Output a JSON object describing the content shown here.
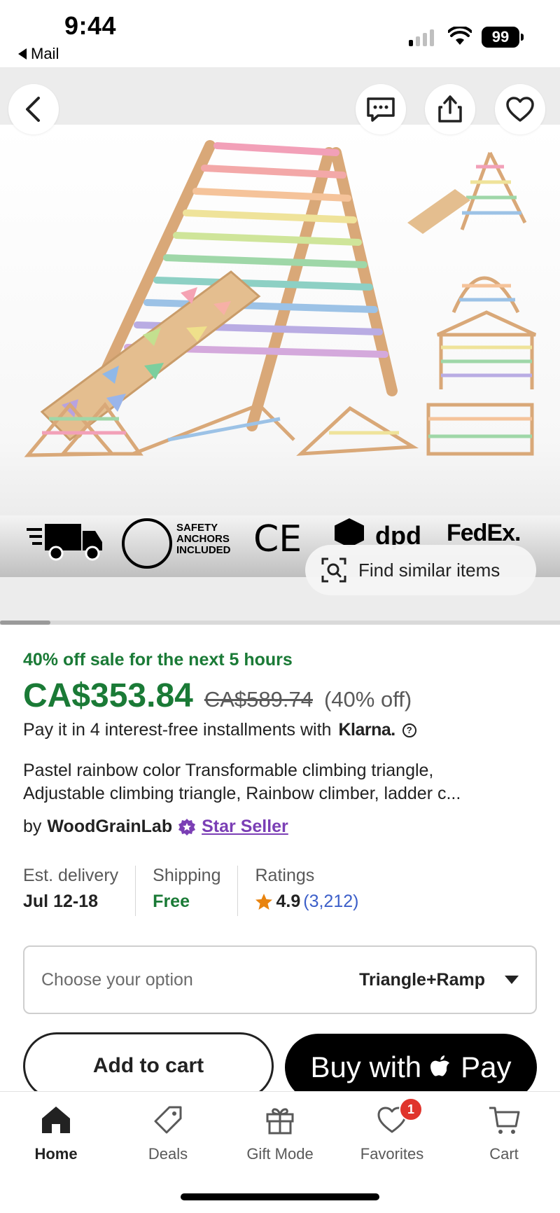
{
  "status_bar": {
    "time": "9:44",
    "back_app": "Mail",
    "battery": "99"
  },
  "hero": {
    "badges": {
      "safety_text": "SAFETY ANCHORS INCLUDED",
      "ce_mark": "CE",
      "dpd": "dpd",
      "fedex": "FedEx."
    },
    "find_similar_label": "Find similar items",
    "image_index": 1
  },
  "product": {
    "sale_banner": "40% off sale for the next 5 hours",
    "price": "CA$353.84",
    "original_price": "CA$589.74",
    "discount": "(40% off)",
    "installments_text": "Pay it in 4 interest-free installments with",
    "klarna": "Klarna.",
    "title_line1": "Pastel rainbow color Transformable climbing triangle,",
    "title_line2": "Adjustable climbing triangle, Rainbow climber, ladder c...",
    "seller_prefix": "by",
    "seller_name": "WoodGrainLab",
    "star_seller": "Star Seller"
  },
  "meta": {
    "delivery_label": "Est. delivery",
    "delivery_value": "Jul 12-18",
    "shipping_label": "Shipping",
    "shipping_value": "Free",
    "ratings_label": "Ratings",
    "rating_value": "4.9",
    "rating_count": "(3,212)"
  },
  "variant_select": {
    "placeholder": "Choose your option",
    "selected": "Triangle+Ramp"
  },
  "actions": {
    "add_to_cart": "Add to cart",
    "buy_with": "Buy with",
    "pay": "Pay"
  },
  "tab_bar": {
    "home": "Home",
    "deals": "Deals",
    "gift_mode": "Gift Mode",
    "favorites": "Favorites",
    "favorites_badge": "1",
    "cart": "Cart"
  },
  "colors": {
    "sale_green": "#1a7a36",
    "star_seller_purple": "#7b3fb5",
    "link_blue": "#3c5fc9",
    "badge_red": "#e0342c"
  }
}
